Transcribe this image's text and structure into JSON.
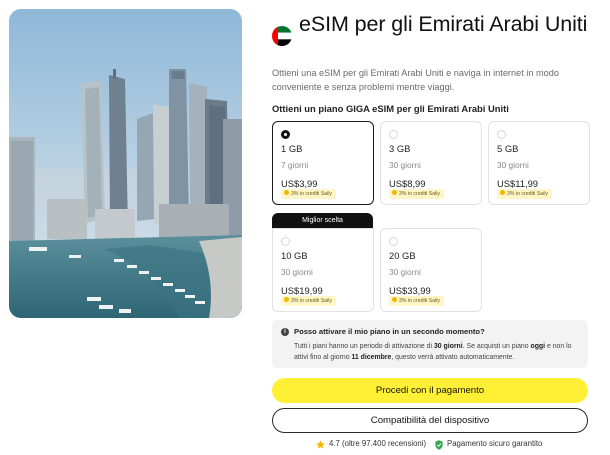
{
  "product": {
    "title": "eSIM per gli Emirati Arabi Uniti",
    "flag_icon": "uae-flag-icon",
    "description": "Ottieni una eSIM per gli Emirati Arabi Uniti e naviga in internet in modo conveniente e senza problemi mentre viaggi."
  },
  "plans": {
    "section_title": "Ottieni un piano GIGA eSIM per gli Emirati Arabi Uniti",
    "best_choice_label": "Miglior scelta",
    "credit_coin_icon": "coin-icon",
    "items": [
      {
        "data": "1 GB",
        "duration": "7 giorni",
        "price": "US$3,99",
        "credit": "3% in crediti Saily",
        "selected": true
      },
      {
        "data": "3 GB",
        "duration": "30 giorni",
        "price": "US$8,99",
        "credit": "3% in crediti Saily",
        "selected": false
      },
      {
        "data": "5 GB",
        "duration": "30 giorni",
        "price": "US$11,99",
        "credit": "3% in crediti Saily",
        "selected": false
      },
      {
        "data": "10 GB",
        "duration": "30 giorni",
        "price": "US$19,99",
        "credit": "3% in crediti Saily",
        "selected": false,
        "best_choice": true
      },
      {
        "data": "20 GB",
        "duration": "30 giorni",
        "price": "US$33,99",
        "credit": "3% in crediti Saily",
        "selected": false
      }
    ]
  },
  "info": {
    "icon": "info-icon",
    "question": "Posso attivare il mio piano in un secondo momento?",
    "answer_part1": "Tutti i piani hanno un periodo di attivazione di ",
    "answer_bold1": "30 giorni",
    "answer_part2": ". Se acquisti un piano ",
    "answer_bold2": "oggi",
    "answer_part3": " e non lo attivi fino al giorno ",
    "answer_bold3": "11 dicembre",
    "answer_part4": ", questo verrà attivato automaticamente."
  },
  "actions": {
    "checkout_label": "Procedi con il pagamento",
    "compatibility_label": "Compatibilità del dispositivo"
  },
  "footer": {
    "rating_text": "4.7 (oltre 97.400 recensioni)",
    "secure_text": "Pagamento sicuro garantito",
    "star_icon": "star-icon",
    "shield_icon": "shield-check-icon",
    "colors": {
      "star": "#f5b400",
      "shield": "#2fa84f"
    }
  },
  "colors": {
    "primary_button": "#fff035",
    "credit_badge_bg": "#fff6c8",
    "selected_border": "#1b1b1b"
  }
}
